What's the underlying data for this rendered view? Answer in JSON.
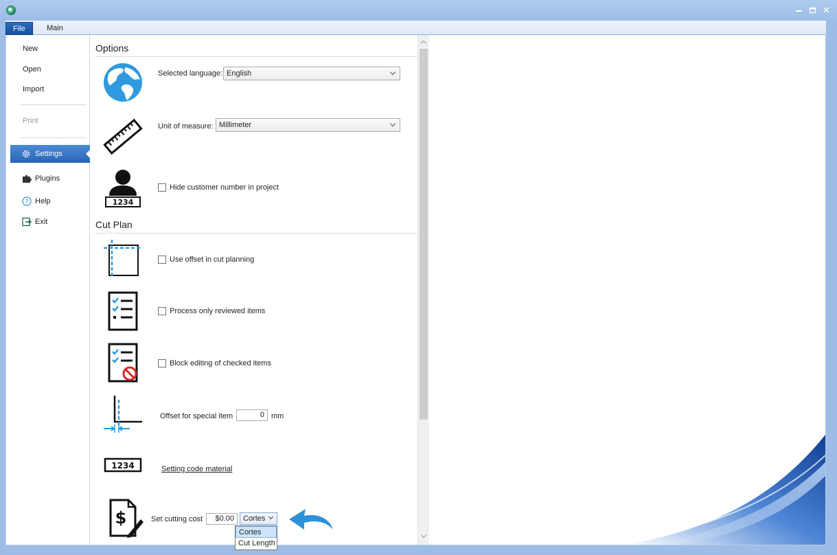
{
  "ribbon": {
    "tabs": [
      {
        "label": "File"
      },
      {
        "label": "Main"
      }
    ]
  },
  "nav": {
    "new": "New",
    "open": "Open",
    "import": "Import",
    "print": "Print",
    "settings": "Settings",
    "plugins": "Plugins",
    "help": "Help",
    "exit": "Exit"
  },
  "options": {
    "header": "Options",
    "language_label": "Selected language:",
    "language_value": "English",
    "unit_label": "Unit of measure:",
    "unit_value": "Millimeter",
    "hide_customer_label": "Hide customer number in project",
    "customer_icon_text": "1234"
  },
  "cutplan": {
    "header": "Cut Plan",
    "use_offset_label": "Use offset in cut planning",
    "process_reviewed_label": "Process only reviewed items",
    "block_editing_label": "Block editing of checked items",
    "offset_special_label": "Offset for special item",
    "offset_special_value": "0",
    "offset_special_unit": "mm",
    "code_icon_text": "1234",
    "setting_code_link": "Setting code material",
    "cutting_cost_label": "Set cutting cost",
    "cutting_cost_value": "$0.00",
    "cost_mode_selected": "Cortes",
    "cost_mode_options": [
      "Cortes",
      "Cut Length"
    ]
  },
  "colors": {
    "accent": "#2a65b5",
    "icon_blue": "#2f9ae0",
    "window": "#9dbde6"
  }
}
